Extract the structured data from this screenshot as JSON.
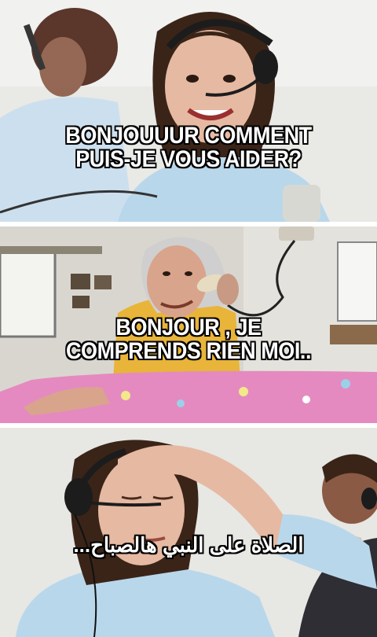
{
  "meme": {
    "panels": [
      {
        "caption": "BONJOUUUR COMMENT\nPUIS-JE VOUS AIDER?"
      },
      {
        "caption": "BONJOUR , JE\nCOMPRENDS RIEN MOI.."
      },
      {
        "caption": "الصلاة على النبي هالصباح..."
      }
    ]
  },
  "colors": {
    "office_wall": "#e9e9e6",
    "shirt_blue": "#b9d7ea",
    "old_shirt_yellow": "#e8b43a",
    "tablecloth_pink": "#e58ac0",
    "skin": "#e6b9a2",
    "hair_dark": "#3a2418",
    "headset": "#1c1c1c"
  }
}
